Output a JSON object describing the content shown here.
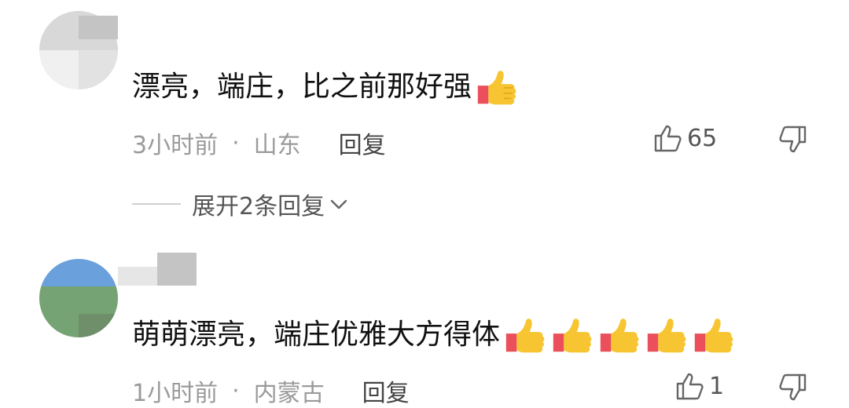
{
  "comments": [
    {
      "text": "漂亮，端庄，比之前那好强",
      "emoji_count": 1,
      "emoji": "thumbs-up-icon",
      "time": "3小时前",
      "dot": "·",
      "location": "山东",
      "reply": "回复",
      "likes": "65",
      "expand_replies": "展开2条回复"
    },
    {
      "text": "萌萌漂亮，端庄优雅大方得体",
      "emoji_count": 5,
      "emoji": "thumbs-up-icon",
      "time": "1小时前",
      "dot": "·",
      "location": "内蒙古",
      "reply": "回复",
      "likes": "1"
    }
  ],
  "colors": {
    "meta_text": "#9a9a9a",
    "thumb_yellow": "#f7c531",
    "cuff_red": "#ea4f5b"
  }
}
